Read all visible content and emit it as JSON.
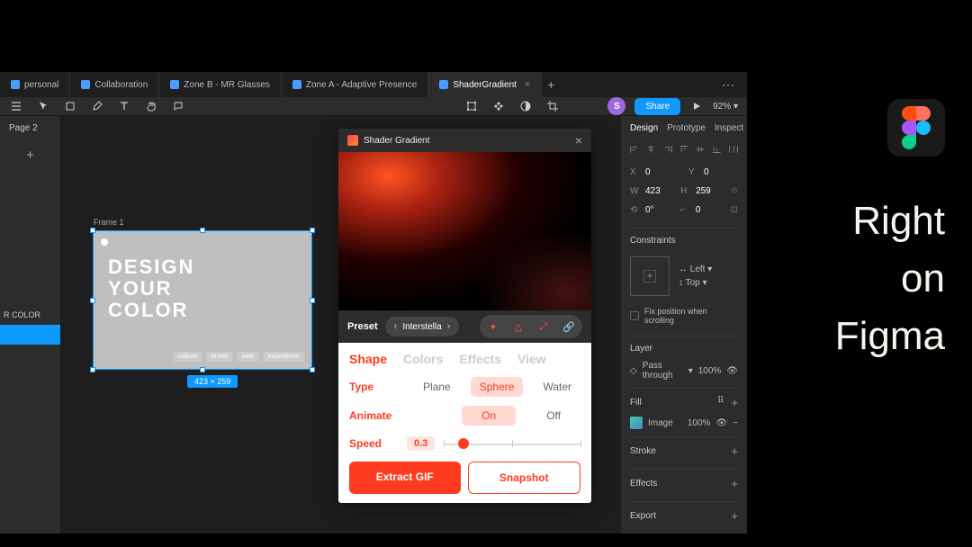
{
  "tabs": [
    {
      "label": "personal"
    },
    {
      "label": "Collaboration"
    },
    {
      "label": "Zone B - MR Glasses"
    },
    {
      "label": "Zone A - Adaptive Presence"
    },
    {
      "label": "ShaderGradient",
      "active": true
    }
  ],
  "toolbar": {
    "avatar_initial": "S",
    "share": "Share",
    "zoom": "92%"
  },
  "left_panel": {
    "page_label": "Page 2",
    "layer_item_partial": "R COLOR"
  },
  "canvas": {
    "frame_label": "Frame 1",
    "frame_text_l1": "DESIGN",
    "frame_text_l2": "YOUR",
    "frame_text_l3": "COLOR",
    "pills": [
      "culture",
      "brand",
      "web",
      "experience"
    ],
    "dim_badge": "423 × 259"
  },
  "plugin": {
    "title": "Shader Gradient",
    "preset_label": "Preset",
    "preset_name": "Interstella",
    "tabs": [
      "Shape",
      "Colors",
      "Effects",
      "View"
    ],
    "active_tab": "Shape",
    "type_label": "Type",
    "type_options": [
      "Plane",
      "Sphere",
      "Water"
    ],
    "type_selected": "Sphere",
    "animate_label": "Animate",
    "animate_options": [
      "On",
      "Off"
    ],
    "animate_selected": "On",
    "speed_label": "Speed",
    "speed_value": "0.3",
    "btn_extract": "Extract GIF",
    "btn_snapshot": "Snapshot"
  },
  "right_panel": {
    "tabs": [
      "Design",
      "Prototype",
      "Inspect"
    ],
    "x": "0",
    "y": "0",
    "w": "423",
    "h": "259",
    "rot": "0°",
    "radius": "0",
    "constraints_head": "Constraints",
    "constraint_h": "Left",
    "constraint_v": "Top",
    "fix_scroll": "Fix position when scrolling",
    "layer_head": "Layer",
    "pass_through": "Pass through",
    "pass_percent": "100%",
    "fill_head": "Fill",
    "fill_type": "Image",
    "fill_percent": "100%",
    "stroke_head": "Stroke",
    "effects_head": "Effects",
    "export_head": "Export"
  },
  "promo": {
    "line1": "Right",
    "line2": "on",
    "line3": "Figma"
  }
}
